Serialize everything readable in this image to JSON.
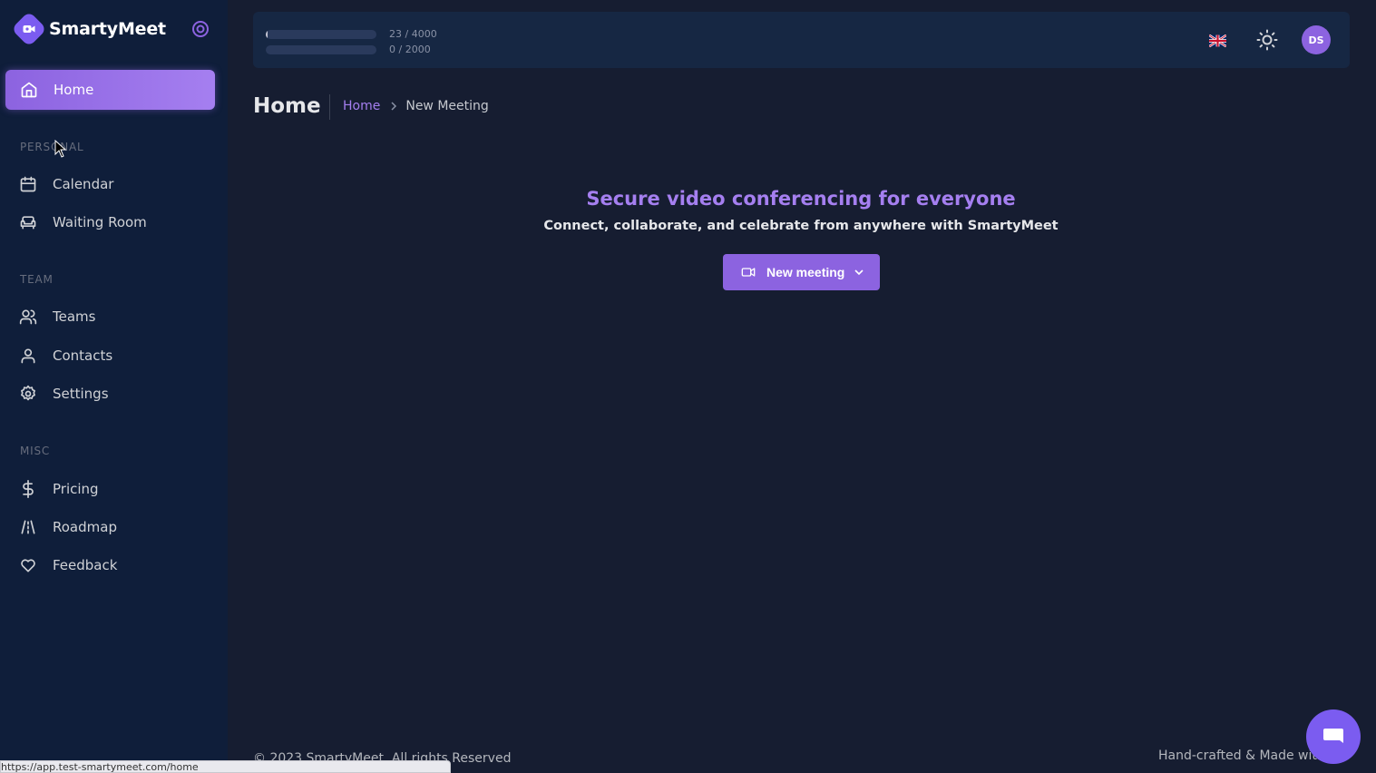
{
  "app": {
    "name": "SmartyMeet"
  },
  "sidebar": {
    "home_label": "Home",
    "sections": [
      {
        "title": "PERSONAL",
        "items": [
          {
            "label": "Calendar",
            "icon": "calendar-icon"
          },
          {
            "label": "Waiting Room",
            "icon": "sofa-icon"
          }
        ]
      },
      {
        "title": "TEAM",
        "items": [
          {
            "label": "Teams",
            "icon": "users-icon"
          },
          {
            "label": "Contacts",
            "icon": "user-icon"
          },
          {
            "label": "Settings",
            "icon": "gear-icon"
          }
        ]
      },
      {
        "title": "MISC",
        "items": [
          {
            "label": "Pricing",
            "icon": "dollar-icon"
          },
          {
            "label": "Roadmap",
            "icon": "road-icon"
          },
          {
            "label": "Feedback",
            "icon": "heart-icon"
          }
        ]
      }
    ]
  },
  "topbar": {
    "usage": [
      {
        "text": "23 / 4000",
        "fraction": 0.00575
      },
      {
        "text": "0 / 2000",
        "fraction": 0
      }
    ],
    "language_flag": "uk-flag-icon",
    "avatar_initials": "DS"
  },
  "header": {
    "title": "Home",
    "breadcrumb": {
      "link": "Home",
      "current": "New Meeting"
    }
  },
  "hero": {
    "title": "Secure video conferencing for everyone",
    "subtitle": "Connect, collaborate, and celebrate from anywhere with SmartyMeet",
    "new_meeting_label": "New meeting"
  },
  "footer": {
    "copyright": "© 2023 SmartyMeet. All rights Reserved",
    "credit": "Hand-crafted & Made with"
  },
  "status_bar": {
    "url": "https://app.test-smartymeet.com/home"
  },
  "colors": {
    "accent": "#8c63e0",
    "sidebar_bg": "#0f1e3a",
    "page_bg": "#161d31"
  }
}
